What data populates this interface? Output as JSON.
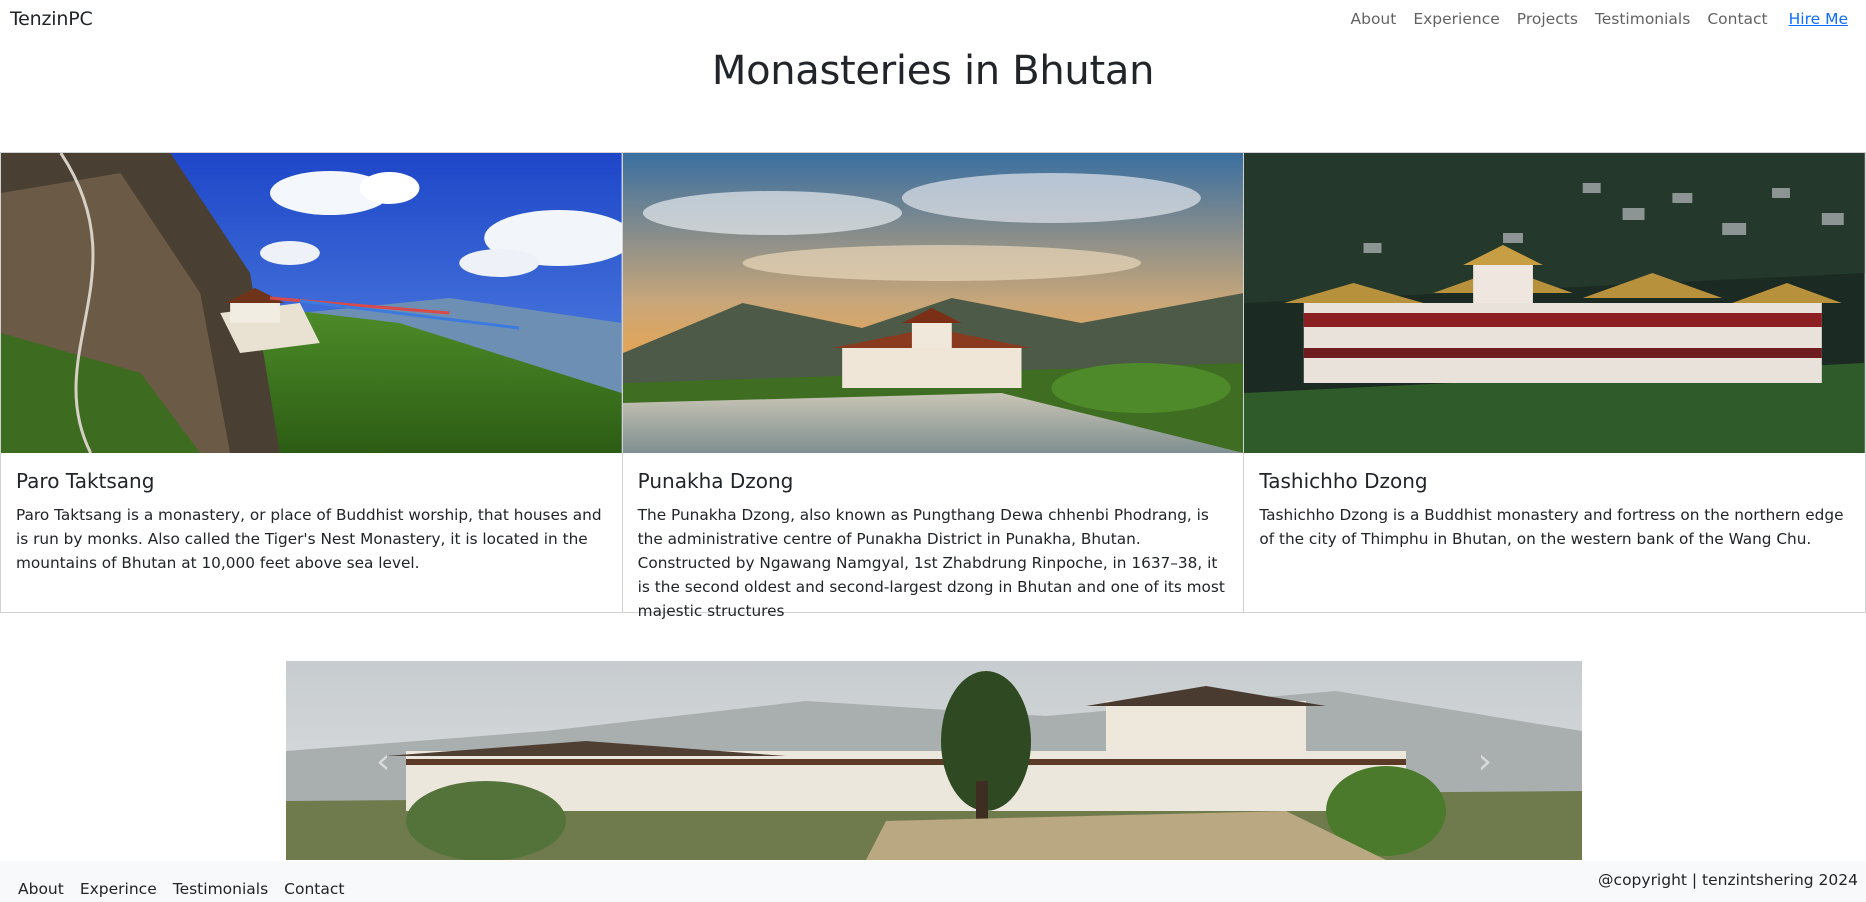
{
  "navbar": {
    "brand": "TenzinPC",
    "links": [
      "About",
      "Experience",
      "Projects",
      "Testimonials",
      "Contact"
    ],
    "hire": "Hire Me"
  },
  "page": {
    "title": "Monasteries in Bhutan"
  },
  "cards": [
    {
      "title": "Paro Taktsang",
      "text": "Paro Taktsang is a monastery, or place of Buddhist worship, that houses and is run by monks. Also called the Tiger's Nest Monastery, it is located in the mountains of Bhutan at 10,000 feet above sea level."
    },
    {
      "title": "Punakha Dzong",
      "text": "The Punakha Dzong, also known as Pungthang Dewa chhenbi Phodrang, is the administrative centre of Punakha District in Punakha, Bhutan. Constructed by Ngawang Namgyal, 1st Zhabdrung Rinpoche, in 1637–38, it is the second oldest and second-largest dzong in Bhutan and one of its most majestic structures"
    },
    {
      "title": "Tashichho Dzong",
      "text": "Tashichho Dzong is a Buddhist monastery and fortress on the northern edge of the city of Thimphu in Bhutan, on the western bank of the Wang Chu."
    }
  ],
  "carousel": {
    "prev_icon": "‹",
    "next_icon": "›"
  },
  "footer": {
    "links": [
      "About",
      "Experince",
      "Testimonials",
      "Contact"
    ],
    "copyright": "@copyright | tenzintshering 2024"
  },
  "colors": {
    "link": "#0d6efd",
    "footer_bg": "#f8f9fa",
    "text": "#212529"
  }
}
